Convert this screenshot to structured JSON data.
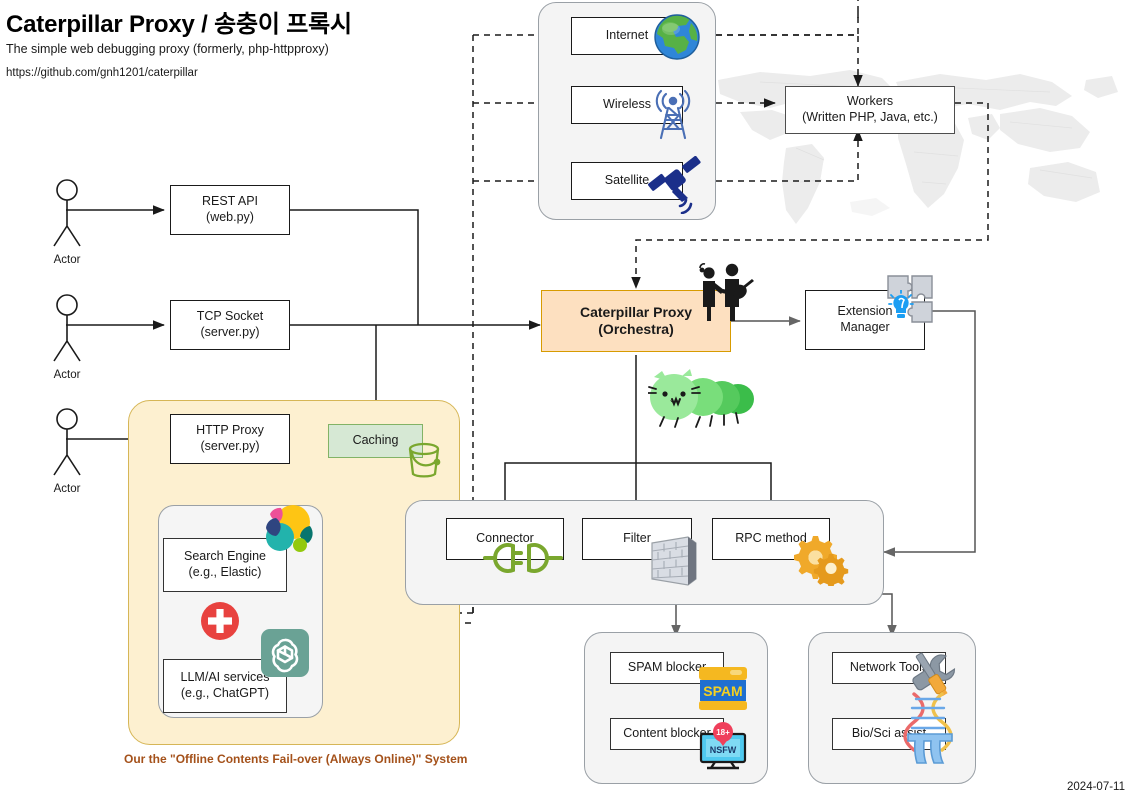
{
  "header": {
    "title": "Caterpillar Proxy / 송충이 프록시",
    "subtitle": "The simple web debugging proxy (formerly, php-httpproxy)",
    "url": "https://github.com/gnh1201/caterpillar",
    "date": "2024-07-11"
  },
  "actors": [
    {
      "label": "Actor"
    },
    {
      "label": "Actor"
    },
    {
      "label": "Actor"
    }
  ],
  "entrypoints": [
    {
      "line1": "REST API",
      "line2": "(web.py)"
    },
    {
      "line1": "TCP Socket",
      "line2": "(server.py)"
    },
    {
      "line1": "HTTP Proxy",
      "line2": "(server.py)"
    }
  ],
  "network_cluster": {
    "items": [
      {
        "label": "Internet",
        "icon": "globe-icon"
      },
      {
        "label": "Wireless",
        "icon": "antenna-tower-icon"
      },
      {
        "label": "Satellite",
        "icon": "satellite-icon"
      }
    ]
  },
  "workers": {
    "line1": "Workers",
    "line2": "(Written PHP, Java, etc.)"
  },
  "proxy": {
    "line1": "Caterpillar Proxy",
    "line2": "(Orchestra)",
    "mascot_icon": "caterpillar-mascot-icon",
    "band_icon": "musicians-icon",
    "fill": "#fde0c0",
    "stroke": "#d79b00"
  },
  "extension_manager": {
    "line1": "Extension",
    "line2": "Manager",
    "icon": "puzzle-piece-icon",
    "icon2": "lightbulb-icon"
  },
  "caching": {
    "label": "Caching",
    "icon": "bucket-icon",
    "fill": "#d6e8d4",
    "stroke": "#82b366"
  },
  "offline_group": {
    "caption": "Our the \"Offline Contents Fail-over (Always Online)\" System",
    "caption_color": "#a4511a",
    "fill": "#fdf0d0",
    "stroke": "#d6b656",
    "items": [
      {
        "line1": "Search Engine",
        "line2": "(e.g., Elastic)",
        "icon": "elastic-logo-icon"
      },
      {
        "line1": "LLM/AI services",
        "line2": "(e.g., ChatGPT)",
        "icon": "openai-logo-icon"
      }
    ],
    "plus_icon": "red-plus-icon"
  },
  "processing_cluster": {
    "items": [
      {
        "label": "Connector",
        "icon": "plug-connector-icon"
      },
      {
        "label": "Filter",
        "icon": "brick-wall-icon"
      },
      {
        "label": "RPC method",
        "icon": "gears-icon"
      }
    ]
  },
  "blocker_cluster": {
    "items": [
      {
        "label": "SPAM blocker",
        "icon": "spam-can-icon"
      },
      {
        "label": "Content blocker",
        "icon": "nsfw-monitor-icon"
      }
    ]
  },
  "tools_cluster": {
    "items": [
      {
        "label": "Network Tools",
        "icon": "wrench-screwdriver-icon"
      },
      {
        "label": "Bio/Sci assist",
        "icon": "dna-pi-icon"
      }
    ]
  }
}
